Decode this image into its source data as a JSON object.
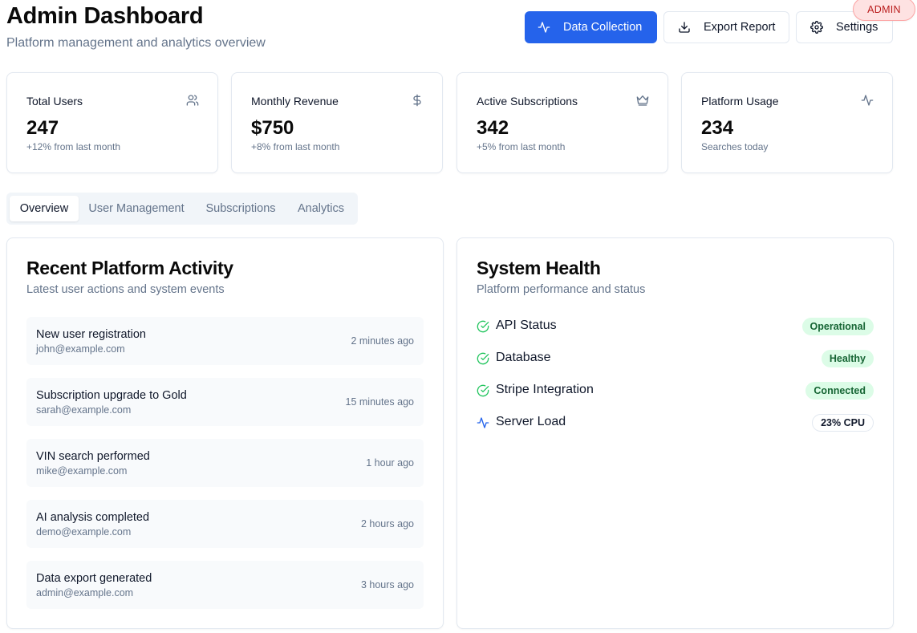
{
  "header": {
    "title": "Admin Dashboard",
    "subtitle": "Platform management and analytics overview",
    "buttons": {
      "data_collection": "Data Collection",
      "export_report": "Export Report",
      "settings": "Settings"
    },
    "role_badge": "ADMIN"
  },
  "stats": [
    {
      "label": "Total Users",
      "value": "247",
      "sub": "+12% from last month",
      "icon": "users-icon"
    },
    {
      "label": "Monthly Revenue",
      "value": "$750",
      "sub": "+8% from last month",
      "icon": "dollar-icon"
    },
    {
      "label": "Active Subscriptions",
      "value": "342",
      "sub": "+5% from last month",
      "icon": "crown-icon"
    },
    {
      "label": "Platform Usage",
      "value": "234",
      "sub": "Searches today",
      "icon": "activity-icon"
    }
  ],
  "tabs": [
    {
      "label": "Overview",
      "active": true
    },
    {
      "label": "User Management",
      "active": false
    },
    {
      "label": "Subscriptions",
      "active": false
    },
    {
      "label": "Analytics",
      "active": false
    }
  ],
  "activity": {
    "title": "Recent Platform Activity",
    "subtitle": "Latest user actions and system events",
    "items": [
      {
        "title": "New user registration",
        "email": "john@example.com",
        "time": "2 minutes ago"
      },
      {
        "title": "Subscription upgrade to Gold",
        "email": "sarah@example.com",
        "time": "15 minutes ago"
      },
      {
        "title": "VIN search performed",
        "email": "mike@example.com",
        "time": "1 hour ago"
      },
      {
        "title": "AI analysis completed",
        "email": "demo@example.com",
        "time": "2 hours ago"
      },
      {
        "title": "Data export generated",
        "email": "admin@example.com",
        "time": "3 hours ago"
      }
    ]
  },
  "health": {
    "title": "System Health",
    "subtitle": "Platform performance and status",
    "rows": [
      {
        "label": "API Status",
        "status": "Operational",
        "icon": "check-circle-icon"
      },
      {
        "label": "Database",
        "status": "Healthy",
        "icon": "check-circle-icon"
      },
      {
        "label": "Stripe Integration",
        "status": "Connected",
        "icon": "check-circle-icon"
      },
      {
        "label": "Server Load",
        "status": "23% CPU",
        "icon": "activity-icon"
      }
    ]
  },
  "colors": {
    "primary": "#2563eb",
    "success_bg": "#dcfce7",
    "success_text": "#166534",
    "success_icon": "#22c55e",
    "admin_badge_bg": "#fee2e2",
    "admin_badge_text": "#b91c1c"
  }
}
